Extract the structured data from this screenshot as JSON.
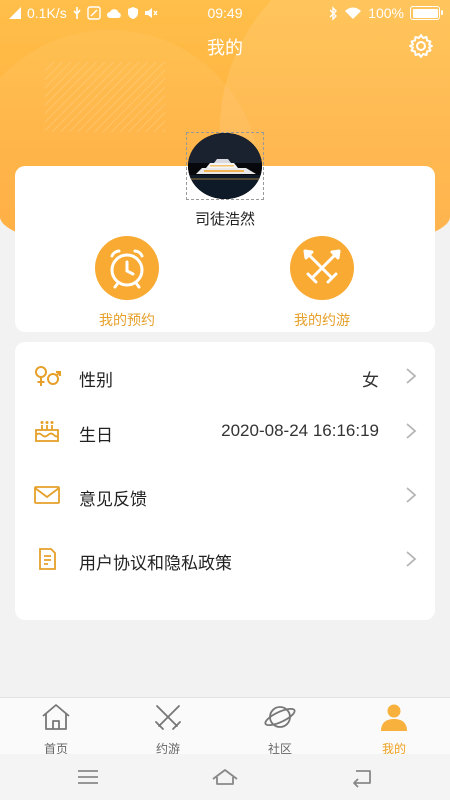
{
  "status_bar": {
    "network_speed": "0.1K/s",
    "time": "09:49",
    "battery": "100%"
  },
  "header": {
    "title": "我的"
  },
  "profile": {
    "username": "司徒浩然"
  },
  "quick_actions": [
    {
      "label": "我的预约",
      "icon": "alarm-clock-icon"
    },
    {
      "label": "我的约游",
      "icon": "crossed-swords-icon"
    }
  ],
  "menu": [
    {
      "label": "性别",
      "value": "女",
      "icon": "gender-icon"
    },
    {
      "label": "生日",
      "value": "2020-08-24 16:16:19",
      "icon": "cake-icon"
    },
    {
      "label": "意见反馈",
      "value": "",
      "icon": "mail-icon"
    },
    {
      "label": "用户协议和隐私政策",
      "value": "",
      "icon": "document-icon"
    }
  ],
  "tabs": [
    {
      "label": "首页",
      "icon": "home-icon",
      "active": false
    },
    {
      "label": "约游",
      "icon": "swords-icon",
      "active": false
    },
    {
      "label": "社区",
      "icon": "planet-icon",
      "active": false
    },
    {
      "label": "我的",
      "icon": "person-icon",
      "active": true
    }
  ],
  "colors": {
    "accent": "#f8aa32",
    "accent_text": "#e6a02a",
    "header": "#ffb03e"
  }
}
